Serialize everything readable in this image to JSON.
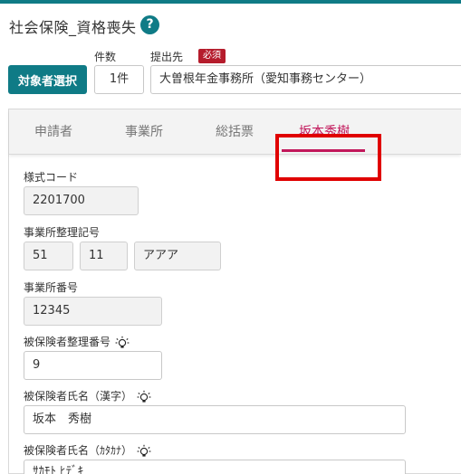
{
  "header": {
    "title": "社会保険_資格喪失",
    "help_icon": "?",
    "count_label": "件数",
    "destination_label": "提出先",
    "required_badge": "必須"
  },
  "toolbar": {
    "select_button": "対象者選択",
    "count_value": "1件",
    "destination_value": "大曽根年金事務所（愛知事務センター）"
  },
  "tabs": [
    {
      "label": "申請者",
      "active": false
    },
    {
      "label": "事業所",
      "active": false
    },
    {
      "label": "総括票",
      "active": false
    },
    {
      "label": "坂本秀樹",
      "active": true
    }
  ],
  "form": {
    "style_code": {
      "label": "様式コード",
      "value": "2201700"
    },
    "office_ref": {
      "label": "事業所整理記号",
      "part1": "51",
      "part2": "11",
      "part3": "アアア"
    },
    "office_number": {
      "label": "事業所番号",
      "value": "12345"
    },
    "insured_ref": {
      "label": "被保険者整理番号",
      "value": "9"
    },
    "insured_name_kanji": {
      "label": "被保険者氏名（漢字）",
      "value": "坂本　秀樹"
    },
    "insured_name_kana": {
      "label": "被保険者氏名（ｶﾀｶﾅ）",
      "value": "ｻｶﾓﾄ ﾋﾃﾞｷ"
    }
  },
  "colors": {
    "accent": "#0f7b86",
    "active_tab": "#c2185b",
    "required": "#b51c2c",
    "highlight": "#e00000"
  }
}
